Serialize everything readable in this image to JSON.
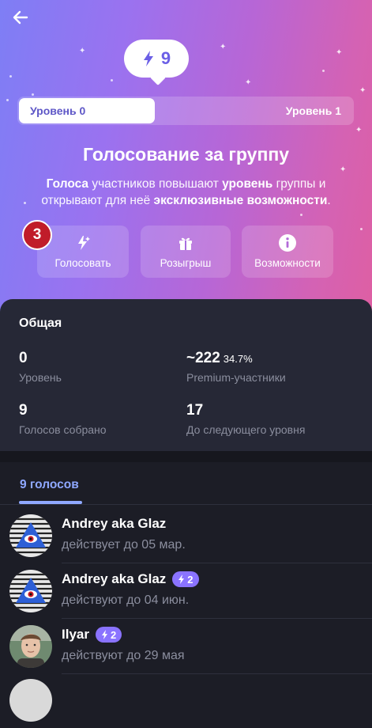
{
  "header": {
    "back_icon": "arrow-left-icon"
  },
  "bubble": {
    "icon": "lightning-icon",
    "count": "9"
  },
  "level_bar": {
    "current": "Уровень 0",
    "next": "Уровень 1",
    "progress_fraction": 0.41
  },
  "title": "Голосование за группу",
  "subtitle": {
    "part1": "Голоса",
    "part2": " участников повышают ",
    "part3": "уровень",
    "part4": " группы и открывают для неё ",
    "part5": "эксклюзивные возможности",
    "part6": "."
  },
  "step_badge": "3",
  "actions": [
    {
      "label": "Голосовать",
      "icon": "lightning-sparkle-icon"
    },
    {
      "label": "Розыгрыш",
      "icon": "gift-icon"
    },
    {
      "label": "Возможности",
      "icon": "info-icon"
    }
  ],
  "stats": {
    "heading": "Общая",
    "level": {
      "value": "0",
      "label": "Уровень"
    },
    "premium": {
      "value": "~222",
      "percent": "34.7%",
      "label": "Premium-участники"
    },
    "collected": {
      "value": "9",
      "label": "Голосов собрано"
    },
    "to_next": {
      "value": "17",
      "label": "До следующего уровня"
    }
  },
  "votes": {
    "tab_label": "9 голосов",
    "items": [
      {
        "name": "Andrey aka Glaz",
        "boost": "",
        "sub": "действует до 05 мар."
      },
      {
        "name": "Andrey aka Glaz",
        "boost": "2",
        "sub": "действуют до 04 июн."
      },
      {
        "name": "Ilyar",
        "boost": "2",
        "sub": "действуют до 29 мая"
      }
    ]
  },
  "colors": {
    "accent": "#8fa8ff",
    "boost_pill": "#8a73ff",
    "badge": "#c01c2a"
  }
}
